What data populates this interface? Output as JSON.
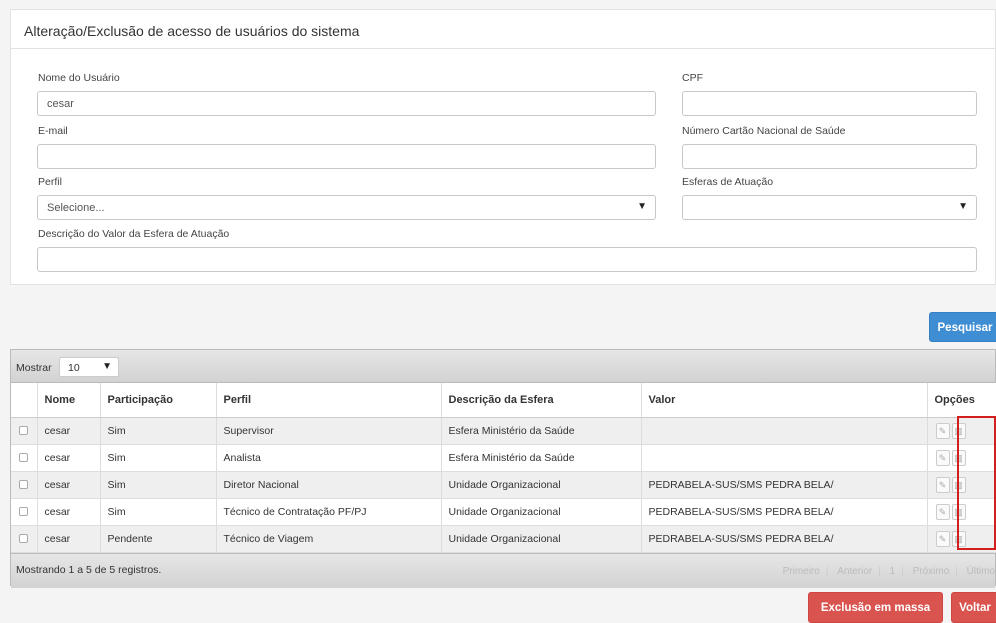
{
  "panel": {
    "title": "Alteração/Exclusão de acesso de usuários do sistema"
  },
  "form": {
    "nome_label": "Nome do Usuário",
    "nome_value": "cesar",
    "cpf_label": "CPF",
    "cpf_value": "",
    "email_label": "E-mail",
    "email_value": "",
    "cns_label": "Número Cartão Nacional de Saúde",
    "cns_value": "",
    "perfil_label": "Perfil",
    "perfil_selected": "Selecione...",
    "esferas_label": "Esferas de Atuação",
    "esferas_selected": "",
    "descricao_label": "Descrição do Valor da Esfera de Atuação",
    "descricao_value": ""
  },
  "buttons": {
    "pesquisar": "Pesquisar",
    "exclusao": "Exclusão em massa",
    "voltar": "Voltar"
  },
  "grid": {
    "mostrar_label": "Mostrar",
    "page_length": "10",
    "columns": [
      "Nome",
      "Participação",
      "Perfil",
      "Descrição da Esfera",
      "Valor",
      "Opções"
    ],
    "rows": [
      {
        "nome": "cesar",
        "participacao": "Sim",
        "perfil": "Supervisor",
        "esfera": "Esfera Ministério da Saúde",
        "valor": ""
      },
      {
        "nome": "cesar",
        "participacao": "Sim",
        "perfil": "Analista",
        "esfera": "Esfera Ministério da Saúde",
        "valor": ""
      },
      {
        "nome": "cesar",
        "participacao": "Sim",
        "perfil": "Diretor Nacional",
        "esfera": "Unidade Organizacional",
        "valor": "PEDRABELA-SUS/SMS PEDRA BELA/"
      },
      {
        "nome": "cesar",
        "participacao": "Sim",
        "perfil": "Técnico de Contratação PF/PJ",
        "esfera": "Unidade Organizacional",
        "valor": "PEDRABELA-SUS/SMS PEDRA BELA/"
      },
      {
        "nome": "cesar",
        "participacao": "Pendente",
        "perfil": "Técnico de Viagem",
        "esfera": "Unidade Organizacional",
        "valor": "PEDRABELA-SUS/SMS PEDRA BELA/"
      }
    ],
    "info": "Mostrando 1 a 5 de 5 registros.",
    "pager": {
      "first": "Primeiro",
      "prev": "Anterior",
      "page": "1",
      "next": "Próximo",
      "last": "Último"
    }
  },
  "icons": {
    "edit": "pencil-icon",
    "delete": "trash-icon"
  },
  "colors": {
    "primary": "#3f8ed4",
    "danger": "#d9534f",
    "highlight": "#d21e1e"
  }
}
